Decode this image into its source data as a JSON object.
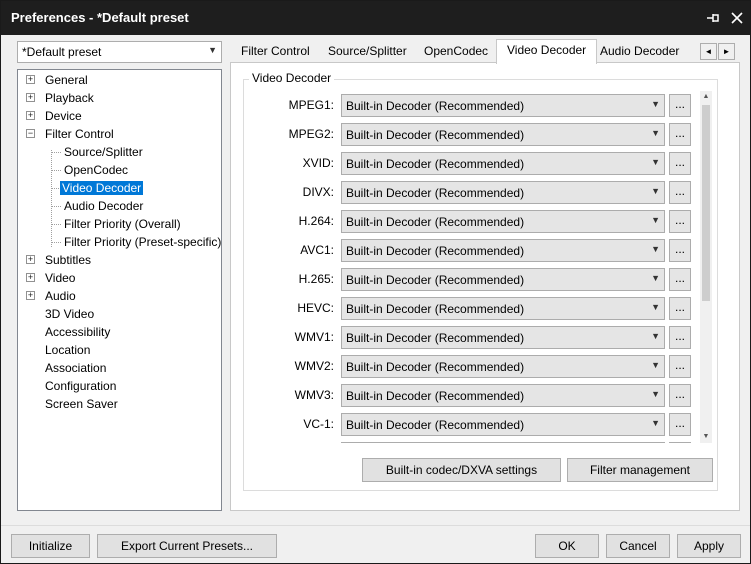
{
  "window": {
    "title": "Preferences - *Default preset",
    "pin_icon": "pin-icon",
    "close_icon": "close-icon"
  },
  "preset": {
    "value": "*Default preset"
  },
  "tree": {
    "items": [
      {
        "label": "General",
        "expander": "+"
      },
      {
        "label": "Playback",
        "expander": "+"
      },
      {
        "label": "Device",
        "expander": "+"
      },
      {
        "label": "Filter Control",
        "expander": "−"
      },
      {
        "label": "Source/Splitter"
      },
      {
        "label": "OpenCodec"
      },
      {
        "label": "Video Decoder",
        "selected": true
      },
      {
        "label": "Audio Decoder"
      },
      {
        "label": "Filter Priority (Overall)"
      },
      {
        "label": "Filter Priority (Preset-specific)"
      },
      {
        "label": "Subtitles",
        "expander": "+"
      },
      {
        "label": "Video",
        "expander": "+"
      },
      {
        "label": "Audio",
        "expander": "+"
      },
      {
        "label": "3D Video"
      },
      {
        "label": "Accessibility"
      },
      {
        "label": "Location"
      },
      {
        "label": "Association"
      },
      {
        "label": "Configuration"
      },
      {
        "label": "Screen Saver"
      }
    ]
  },
  "tabs": [
    {
      "label": "Filter Control"
    },
    {
      "label": "Source/Splitter"
    },
    {
      "label": "OpenCodec"
    },
    {
      "label": "Video Decoder",
      "active": true
    },
    {
      "label": "Audio Decoder"
    }
  ],
  "tab_scroll": {
    "left": "◄",
    "right": "►"
  },
  "group": {
    "title": "Video Decoder",
    "rows": [
      {
        "label": "MPEG1:",
        "value": "Built-in Decoder (Recommended)"
      },
      {
        "label": "MPEG2:",
        "value": "Built-in Decoder (Recommended)"
      },
      {
        "label": "XVID:",
        "value": "Built-in Decoder (Recommended)"
      },
      {
        "label": "DIVX:",
        "value": "Built-in Decoder (Recommended)"
      },
      {
        "label": "H.264:",
        "value": "Built-in Decoder (Recommended)"
      },
      {
        "label": "AVC1:",
        "value": "Built-in Decoder (Recommended)"
      },
      {
        "label": "H.265:",
        "value": "Built-in Decoder (Recommended)"
      },
      {
        "label": "HEVC:",
        "value": "Built-in Decoder (Recommended)"
      },
      {
        "label": "WMV1:",
        "value": "Built-in Decoder (Recommended)"
      },
      {
        "label": "WMV2:",
        "value": "Built-in Decoder (Recommended)"
      },
      {
        "label": "WMV3:",
        "value": "Built-in Decoder (Recommended)"
      },
      {
        "label": "VC-1:",
        "value": "Built-in Decoder (Recommended)"
      }
    ],
    "dots_label": "...",
    "builtin_btn": "Built-in codec/DXVA settings",
    "filter_btn": "Filter management"
  },
  "footer": {
    "initialize": "Initialize",
    "export": "Export Current Presets...",
    "ok": "OK",
    "cancel": "Cancel",
    "apply": "Apply"
  }
}
